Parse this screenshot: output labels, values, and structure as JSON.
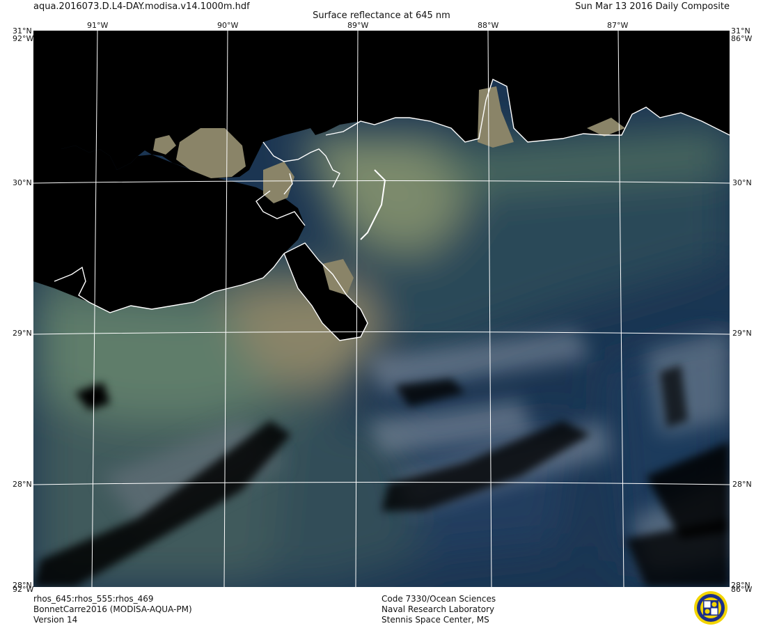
{
  "header": {
    "file_name": "aqua.2016073.D.L4-DAY.modisa.v14.1000m.hdf",
    "title": "Surface reflectance at 645 nm",
    "composite": "Sun Mar 13 2016 Daily Composite"
  },
  "map": {
    "lon_labels": [
      "91°W",
      "90°W",
      "89°W",
      "88°W",
      "87°W"
    ],
    "lat_labels": [
      "31°N",
      "30°N",
      "29°N",
      "28°N"
    ],
    "corner_labels": {
      "top_left_lat": "31°N",
      "top_left_lon": "92°W",
      "top_right_lat": "31°N",
      "top_right_lon": "86°W",
      "bottom_left_lat": "28°N",
      "bottom_left_lon": "92°W",
      "bottom_right_lat": "28°N",
      "bottom_right_lon": "86°W"
    },
    "colors": {
      "land": "#000000",
      "coastline": "#ffffff",
      "graticule": "#ffffff",
      "sediment": "#8a8468",
      "turbid_green": "#5f7d6b",
      "shelf_water": "#3f5a5c",
      "deep_water": "#1b3552",
      "haze": "#8a96a6"
    }
  },
  "footer": {
    "left": [
      "rhos_645:rhos_555:rhos_469",
      "BonnetCarre2016 (MODISA-AQUA-PM)",
      "Version 14"
    ],
    "center": [
      "Code 7330/Ocean Sciences",
      "Naval Research Laboratory",
      "Stennis Space Center, MS"
    ]
  },
  "logo": {
    "icon": "nrl-seal-icon"
  }
}
